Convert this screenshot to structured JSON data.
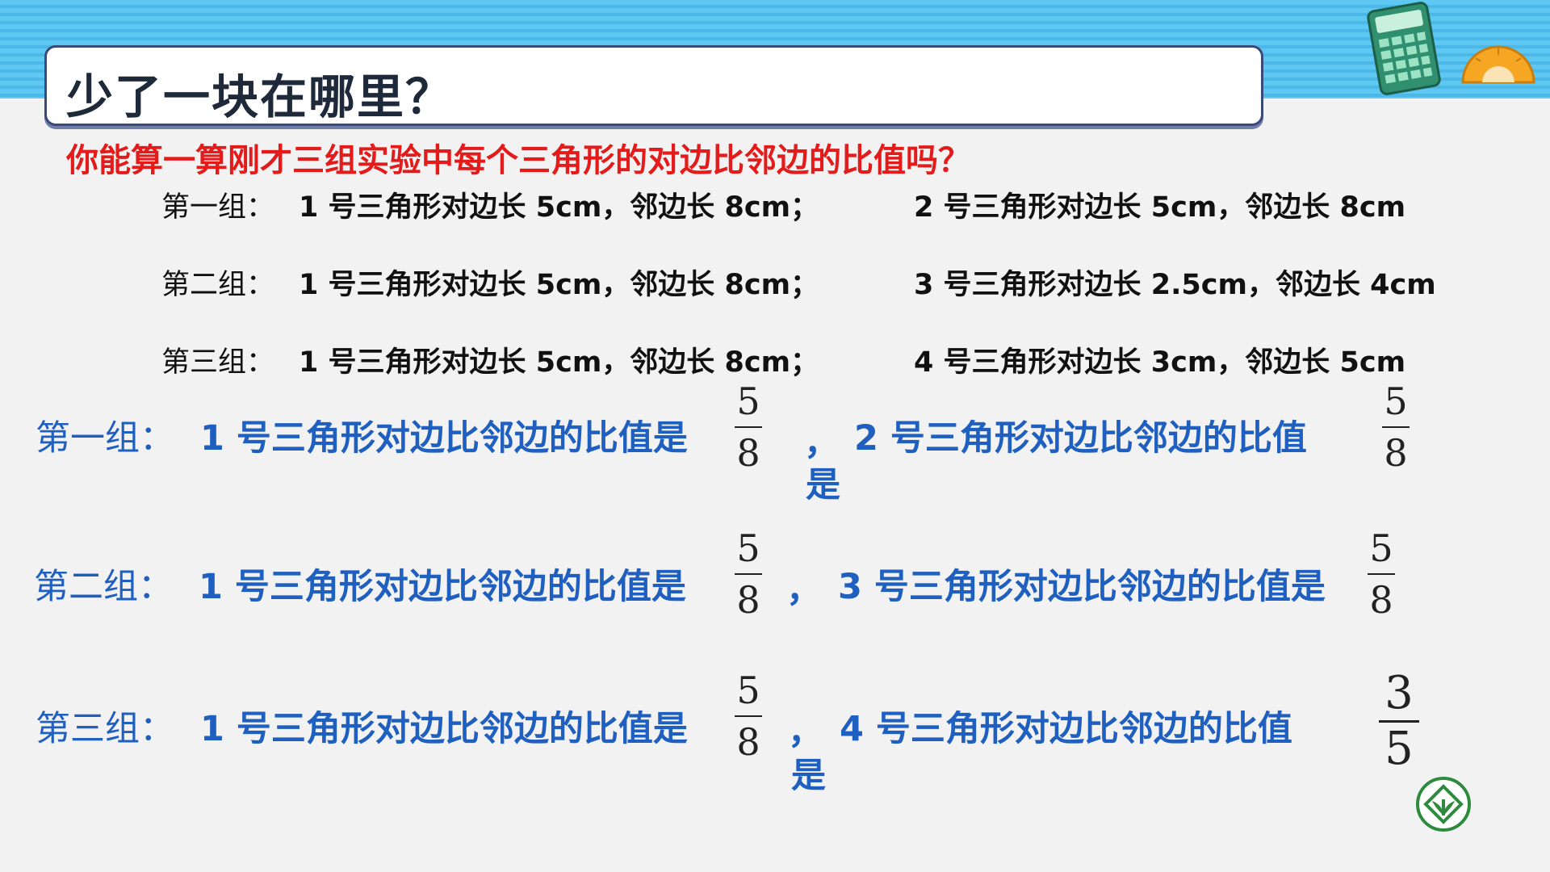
{
  "slide": {
    "title": "少了一块在哪里？",
    "question": "你能算一算刚才三组实验中每个三角形的对边比邻边的比值吗？"
  },
  "data_rows": [
    {
      "group": "第一组：",
      "first": "1 号三角形对边长 5cm，邻边长 8cm；",
      "second": "2 号三角形对边长 5cm，邻边长 8cm"
    },
    {
      "group": "第二组：",
      "first": "1 号三角形对边长 5cm，邻边长 8cm；",
      "second": "3 号三角形对边长 2.5cm，邻边长 4cm"
    },
    {
      "group": "第三组：",
      "first": "1 号三角形对边长 5cm，邻边长 8cm；",
      "second": "4 号三角形对边长 3cm，邻边长 5cm"
    }
  ],
  "answers": [
    {
      "group": "第一组：",
      "first_text": "1 号三角形对边比邻边的比值是",
      "first_frac": {
        "num": "5",
        "den": "8"
      },
      "comma": "，",
      "second_text": "2 号三角形对边比邻边的比值",
      "second_tail": "是",
      "second_frac": {
        "num": "5",
        "den": "8"
      }
    },
    {
      "group": "第二组：",
      "first_text": "1 号三角形对边比邻边的比值是",
      "first_frac": {
        "num": "5",
        "den": "8"
      },
      "comma": "，",
      "second_text": "3 号三角形对边比邻边的比值是",
      "second_frac": {
        "num": "5",
        "den": "8"
      }
    },
    {
      "group": "第三组：",
      "first_text": "1 号三角形对边比邻边的比值是",
      "first_frac": {
        "num": "5",
        "den": "8"
      },
      "comma": "，",
      "second_text": "4 号三角形对边比邻边的比值",
      "second_tail": "是",
      "second_frac": {
        "num": "3",
        "den": "5"
      }
    }
  ],
  "decorations": {
    "top_icons": [
      "calculator-icon",
      "protractor-icon"
    ],
    "bottom_logo": "school-logo-icon",
    "colors": {
      "title_border": "#3a4a78",
      "question": "#e31b1b",
      "answer": "#1f5fbf",
      "band": "#5ec8f2"
    }
  }
}
